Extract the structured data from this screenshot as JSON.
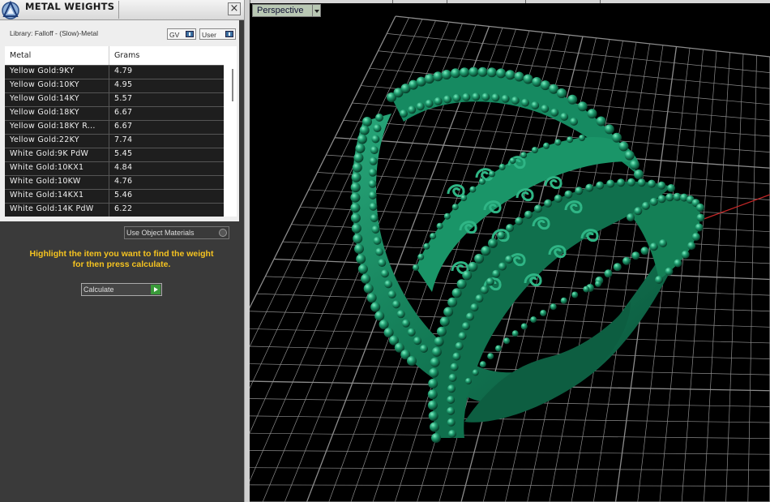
{
  "panel": {
    "title": "METAL WEIGHTS",
    "close_label": "×",
    "library_label": "Library: Falloff - (Slow)-Metal",
    "gv_label": "GV",
    "user_label": "User",
    "table": {
      "columns": [
        "Metal",
        "Grams"
      ],
      "rows": [
        {
          "metal": "Yellow Gold:9KY",
          "grams": "4.79"
        },
        {
          "metal": "Yellow Gold:10KY",
          "grams": "4.95"
        },
        {
          "metal": "Yellow Gold:14KY",
          "grams": "5.57"
        },
        {
          "metal": "Yellow Gold:18KY",
          "grams": "6.67"
        },
        {
          "metal": "Yellow Gold:18KY R...",
          "grams": "6.67"
        },
        {
          "metal": "Yellow Gold:22KY",
          "grams": "7.74"
        },
        {
          "metal": "White Gold:9K PdW",
          "grams": "5.45"
        },
        {
          "metal": "White Gold:10KX1",
          "grams": "4.84"
        },
        {
          "metal": "White Gold:10KW",
          "grams": "4.76"
        },
        {
          "metal": "White Gold:14KX1",
          "grams": "5.46"
        },
        {
          "metal": "White Gold:14K PdW",
          "grams": "6.22"
        }
      ]
    },
    "material_select": "Use Object Materials",
    "instruction_line1": "Highlight the item you want to find the weight",
    "instruction_line2": "for then press calculate.",
    "calculate_label": "Calculate"
  },
  "viewport": {
    "view_label": "Perspective"
  },
  "colors": {
    "model": "#1d8a63",
    "instruction": "#f5c320",
    "grid": "#8c8c8c",
    "x_axis": "#c62828"
  },
  "icons": {
    "app_logo": "rhino-triangle-logo",
    "close": "close-icon",
    "view_menu": "chevron-down-icon",
    "calculate": "play-icon"
  }
}
